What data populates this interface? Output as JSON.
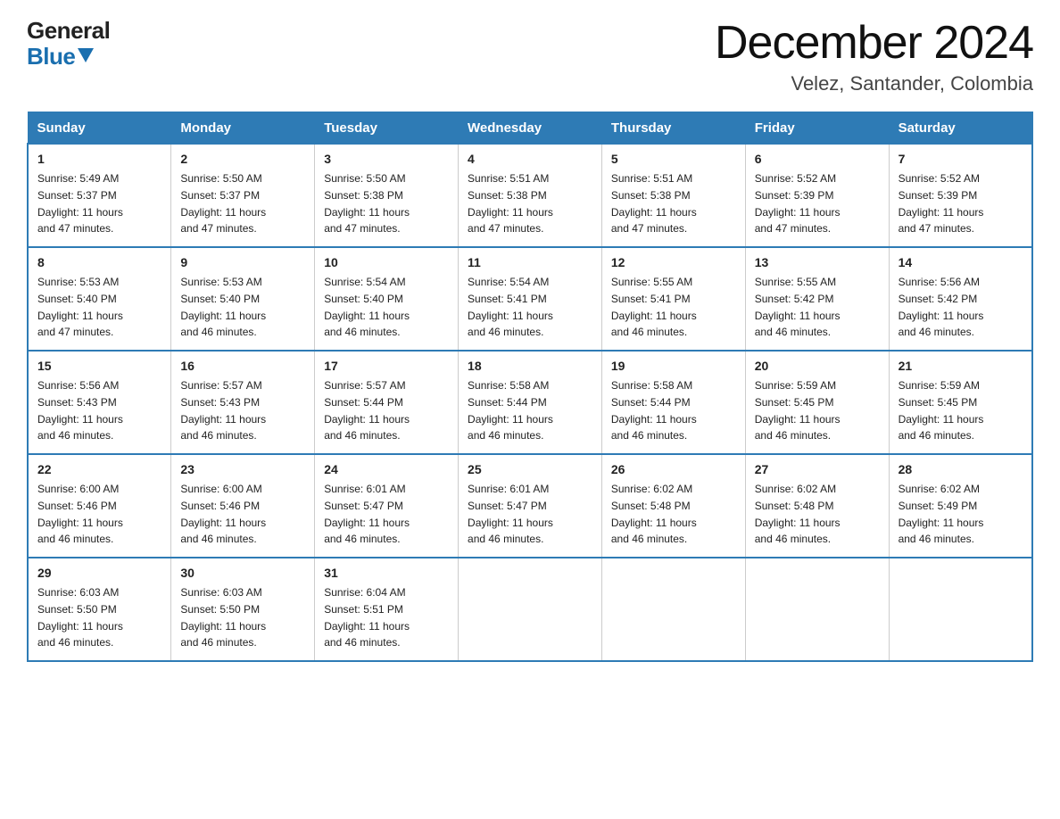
{
  "logo": {
    "general": "General",
    "blue": "Blue"
  },
  "header": {
    "month": "December 2024",
    "location": "Velez, Santander, Colombia"
  },
  "days_of_week": [
    "Sunday",
    "Monday",
    "Tuesday",
    "Wednesday",
    "Thursday",
    "Friday",
    "Saturday"
  ],
  "weeks": [
    [
      {
        "num": "1",
        "sunrise": "5:49 AM",
        "sunset": "5:37 PM",
        "daylight": "11 hours and 47 minutes."
      },
      {
        "num": "2",
        "sunrise": "5:50 AM",
        "sunset": "5:37 PM",
        "daylight": "11 hours and 47 minutes."
      },
      {
        "num": "3",
        "sunrise": "5:50 AM",
        "sunset": "5:38 PM",
        "daylight": "11 hours and 47 minutes."
      },
      {
        "num": "4",
        "sunrise": "5:51 AM",
        "sunset": "5:38 PM",
        "daylight": "11 hours and 47 minutes."
      },
      {
        "num": "5",
        "sunrise": "5:51 AM",
        "sunset": "5:38 PM",
        "daylight": "11 hours and 47 minutes."
      },
      {
        "num": "6",
        "sunrise": "5:52 AM",
        "sunset": "5:39 PM",
        "daylight": "11 hours and 47 minutes."
      },
      {
        "num": "7",
        "sunrise": "5:52 AM",
        "sunset": "5:39 PM",
        "daylight": "11 hours and 47 minutes."
      }
    ],
    [
      {
        "num": "8",
        "sunrise": "5:53 AM",
        "sunset": "5:40 PM",
        "daylight": "11 hours and 47 minutes."
      },
      {
        "num": "9",
        "sunrise": "5:53 AM",
        "sunset": "5:40 PM",
        "daylight": "11 hours and 46 minutes."
      },
      {
        "num": "10",
        "sunrise": "5:54 AM",
        "sunset": "5:40 PM",
        "daylight": "11 hours and 46 minutes."
      },
      {
        "num": "11",
        "sunrise": "5:54 AM",
        "sunset": "5:41 PM",
        "daylight": "11 hours and 46 minutes."
      },
      {
        "num": "12",
        "sunrise": "5:55 AM",
        "sunset": "5:41 PM",
        "daylight": "11 hours and 46 minutes."
      },
      {
        "num": "13",
        "sunrise": "5:55 AM",
        "sunset": "5:42 PM",
        "daylight": "11 hours and 46 minutes."
      },
      {
        "num": "14",
        "sunrise": "5:56 AM",
        "sunset": "5:42 PM",
        "daylight": "11 hours and 46 minutes."
      }
    ],
    [
      {
        "num": "15",
        "sunrise": "5:56 AM",
        "sunset": "5:43 PM",
        "daylight": "11 hours and 46 minutes."
      },
      {
        "num": "16",
        "sunrise": "5:57 AM",
        "sunset": "5:43 PM",
        "daylight": "11 hours and 46 minutes."
      },
      {
        "num": "17",
        "sunrise": "5:57 AM",
        "sunset": "5:44 PM",
        "daylight": "11 hours and 46 minutes."
      },
      {
        "num": "18",
        "sunrise": "5:58 AM",
        "sunset": "5:44 PM",
        "daylight": "11 hours and 46 minutes."
      },
      {
        "num": "19",
        "sunrise": "5:58 AM",
        "sunset": "5:44 PM",
        "daylight": "11 hours and 46 minutes."
      },
      {
        "num": "20",
        "sunrise": "5:59 AM",
        "sunset": "5:45 PM",
        "daylight": "11 hours and 46 minutes."
      },
      {
        "num": "21",
        "sunrise": "5:59 AM",
        "sunset": "5:45 PM",
        "daylight": "11 hours and 46 minutes."
      }
    ],
    [
      {
        "num": "22",
        "sunrise": "6:00 AM",
        "sunset": "5:46 PM",
        "daylight": "11 hours and 46 minutes."
      },
      {
        "num": "23",
        "sunrise": "6:00 AM",
        "sunset": "5:46 PM",
        "daylight": "11 hours and 46 minutes."
      },
      {
        "num": "24",
        "sunrise": "6:01 AM",
        "sunset": "5:47 PM",
        "daylight": "11 hours and 46 minutes."
      },
      {
        "num": "25",
        "sunrise": "6:01 AM",
        "sunset": "5:47 PM",
        "daylight": "11 hours and 46 minutes."
      },
      {
        "num": "26",
        "sunrise": "6:02 AM",
        "sunset": "5:48 PM",
        "daylight": "11 hours and 46 minutes."
      },
      {
        "num": "27",
        "sunrise": "6:02 AM",
        "sunset": "5:48 PM",
        "daylight": "11 hours and 46 minutes."
      },
      {
        "num": "28",
        "sunrise": "6:02 AM",
        "sunset": "5:49 PM",
        "daylight": "11 hours and 46 minutes."
      }
    ],
    [
      {
        "num": "29",
        "sunrise": "6:03 AM",
        "sunset": "5:50 PM",
        "daylight": "11 hours and 46 minutes."
      },
      {
        "num": "30",
        "sunrise": "6:03 AM",
        "sunset": "5:50 PM",
        "daylight": "11 hours and 46 minutes."
      },
      {
        "num": "31",
        "sunrise": "6:04 AM",
        "sunset": "5:51 PM",
        "daylight": "11 hours and 46 minutes."
      },
      null,
      null,
      null,
      null
    ]
  ],
  "labels": {
    "sunrise": "Sunrise:",
    "sunset": "Sunset:",
    "daylight": "Daylight:"
  }
}
